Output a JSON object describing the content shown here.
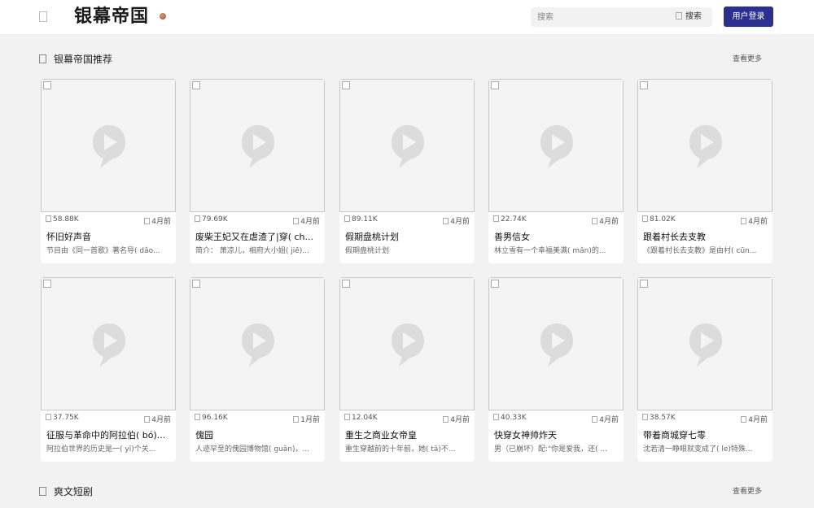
{
  "header": {
    "logo_text": "银幕帝国",
    "search_placeholder": "搜索",
    "search_button": "搜索",
    "login_button": "用户登录"
  },
  "sections": [
    {
      "title": "银幕帝国推荐",
      "more": "查看更多"
    },
    {
      "title": "爽文短剧",
      "more": "查看更多"
    }
  ],
  "cards": [
    {
      "views": "58.88K",
      "time": "4月前",
      "title": "怀旧好声音",
      "desc": "节目由《同一首歌》著名导( dǎo..."
    },
    {
      "views": "79.69K",
      "time": "4月前",
      "title": "废柴王妃又在虐渣了|穿( ch...",
      "desc": "简介： 萧凉儿，相府大小姐( jiě)..."
    },
    {
      "views": "89.11K",
      "time": "4月前",
      "title": "假期盘桃计划",
      "desc": "假期盘桃计划"
    },
    {
      "views": "22.74K",
      "time": "4月前",
      "title": "善男信女",
      "desc": "林立雪有一个幸福美满( mǎn)的..."
    },
    {
      "views": "81.02K",
      "time": "4月前",
      "title": "跟着村长去支教",
      "desc": "《跟着村长去支教》是由村( cūn..."
    },
    {
      "views": "37.75K",
      "time": "4月前",
      "title": "征服与革命中的阿拉伯( bó)...",
      "desc": "阿拉伯世界的历史是一( yī)个关..."
    },
    {
      "views": "96.16K",
      "time": "1月前",
      "title": "傀园",
      "desc": "人迹罕至的傀园博物馆( guǎn)，..."
    },
    {
      "views": "12.04K",
      "time": "4月前",
      "title": "重生之商业女帝皇",
      "desc": "重生穿越前的十年前，她( tā)不..."
    },
    {
      "views": "40.33K",
      "time": "4月前",
      "title": "快穿女神帅炸天",
      "desc": "男（已崩坏）配:\"你是爱我，还( ..."
    },
    {
      "views": "38.57K",
      "time": "4月前",
      "title": "带着商城穿七零",
      "desc": "沈若清一睁眼就变成了( le)特殊..."
    }
  ]
}
